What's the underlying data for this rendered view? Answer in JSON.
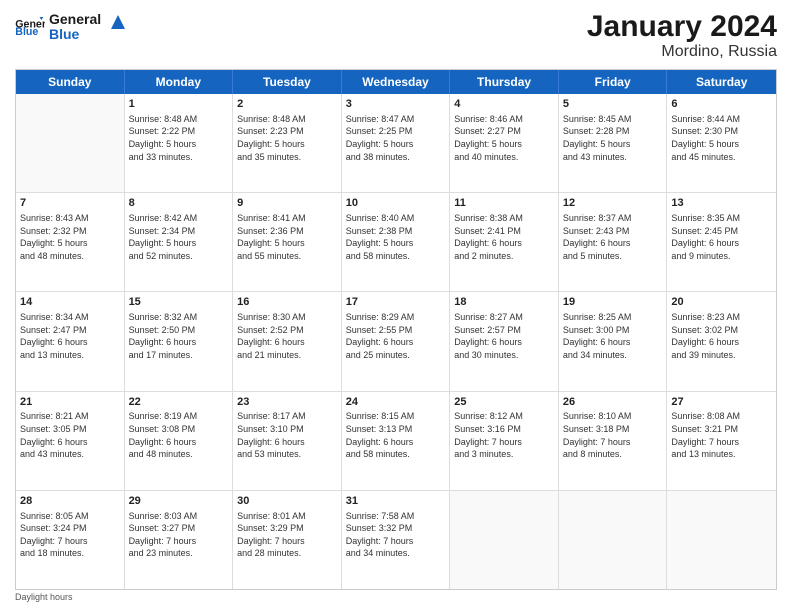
{
  "logo": {
    "line1": "General",
    "line2": "Blue"
  },
  "title": "January 2024",
  "subtitle": "Mordino, Russia",
  "days_of_week": [
    "Sunday",
    "Monday",
    "Tuesday",
    "Wednesday",
    "Thursday",
    "Friday",
    "Saturday"
  ],
  "weeks": [
    [
      {
        "day": "",
        "content": ""
      },
      {
        "day": "1",
        "content": "Sunrise: 8:48 AM\nSunset: 2:22 PM\nDaylight: 5 hours\nand 33 minutes."
      },
      {
        "day": "2",
        "content": "Sunrise: 8:48 AM\nSunset: 2:23 PM\nDaylight: 5 hours\nand 35 minutes."
      },
      {
        "day": "3",
        "content": "Sunrise: 8:47 AM\nSunset: 2:25 PM\nDaylight: 5 hours\nand 38 minutes."
      },
      {
        "day": "4",
        "content": "Sunrise: 8:46 AM\nSunset: 2:27 PM\nDaylight: 5 hours\nand 40 minutes."
      },
      {
        "day": "5",
        "content": "Sunrise: 8:45 AM\nSunset: 2:28 PM\nDaylight: 5 hours\nand 43 minutes."
      },
      {
        "day": "6",
        "content": "Sunrise: 8:44 AM\nSunset: 2:30 PM\nDaylight: 5 hours\nand 45 minutes."
      }
    ],
    [
      {
        "day": "7",
        "content": "Sunrise: 8:43 AM\nSunset: 2:32 PM\nDaylight: 5 hours\nand 48 minutes."
      },
      {
        "day": "8",
        "content": "Sunrise: 8:42 AM\nSunset: 2:34 PM\nDaylight: 5 hours\nand 52 minutes."
      },
      {
        "day": "9",
        "content": "Sunrise: 8:41 AM\nSunset: 2:36 PM\nDaylight: 5 hours\nand 55 minutes."
      },
      {
        "day": "10",
        "content": "Sunrise: 8:40 AM\nSunset: 2:38 PM\nDaylight: 5 hours\nand 58 minutes."
      },
      {
        "day": "11",
        "content": "Sunrise: 8:38 AM\nSunset: 2:41 PM\nDaylight: 6 hours\nand 2 minutes."
      },
      {
        "day": "12",
        "content": "Sunrise: 8:37 AM\nSunset: 2:43 PM\nDaylight: 6 hours\nand 5 minutes."
      },
      {
        "day": "13",
        "content": "Sunrise: 8:35 AM\nSunset: 2:45 PM\nDaylight: 6 hours\nand 9 minutes."
      }
    ],
    [
      {
        "day": "14",
        "content": "Sunrise: 8:34 AM\nSunset: 2:47 PM\nDaylight: 6 hours\nand 13 minutes."
      },
      {
        "day": "15",
        "content": "Sunrise: 8:32 AM\nSunset: 2:50 PM\nDaylight: 6 hours\nand 17 minutes."
      },
      {
        "day": "16",
        "content": "Sunrise: 8:30 AM\nSunset: 2:52 PM\nDaylight: 6 hours\nand 21 minutes."
      },
      {
        "day": "17",
        "content": "Sunrise: 8:29 AM\nSunset: 2:55 PM\nDaylight: 6 hours\nand 25 minutes."
      },
      {
        "day": "18",
        "content": "Sunrise: 8:27 AM\nSunset: 2:57 PM\nDaylight: 6 hours\nand 30 minutes."
      },
      {
        "day": "19",
        "content": "Sunrise: 8:25 AM\nSunset: 3:00 PM\nDaylight: 6 hours\nand 34 minutes."
      },
      {
        "day": "20",
        "content": "Sunrise: 8:23 AM\nSunset: 3:02 PM\nDaylight: 6 hours\nand 39 minutes."
      }
    ],
    [
      {
        "day": "21",
        "content": "Sunrise: 8:21 AM\nSunset: 3:05 PM\nDaylight: 6 hours\nand 43 minutes."
      },
      {
        "day": "22",
        "content": "Sunrise: 8:19 AM\nSunset: 3:08 PM\nDaylight: 6 hours\nand 48 minutes."
      },
      {
        "day": "23",
        "content": "Sunrise: 8:17 AM\nSunset: 3:10 PM\nDaylight: 6 hours\nand 53 minutes."
      },
      {
        "day": "24",
        "content": "Sunrise: 8:15 AM\nSunset: 3:13 PM\nDaylight: 6 hours\nand 58 minutes."
      },
      {
        "day": "25",
        "content": "Sunrise: 8:12 AM\nSunset: 3:16 PM\nDaylight: 7 hours\nand 3 minutes."
      },
      {
        "day": "26",
        "content": "Sunrise: 8:10 AM\nSunset: 3:18 PM\nDaylight: 7 hours\nand 8 minutes."
      },
      {
        "day": "27",
        "content": "Sunrise: 8:08 AM\nSunset: 3:21 PM\nDaylight: 7 hours\nand 13 minutes."
      }
    ],
    [
      {
        "day": "28",
        "content": "Sunrise: 8:05 AM\nSunset: 3:24 PM\nDaylight: 7 hours\nand 18 minutes."
      },
      {
        "day": "29",
        "content": "Sunrise: 8:03 AM\nSunset: 3:27 PM\nDaylight: 7 hours\nand 23 minutes."
      },
      {
        "day": "30",
        "content": "Sunrise: 8:01 AM\nSunset: 3:29 PM\nDaylight: 7 hours\nand 28 minutes."
      },
      {
        "day": "31",
        "content": "Sunrise: 7:58 AM\nSunset: 3:32 PM\nDaylight: 7 hours\nand 34 minutes."
      },
      {
        "day": "",
        "content": ""
      },
      {
        "day": "",
        "content": ""
      },
      {
        "day": "",
        "content": ""
      }
    ]
  ],
  "footer": "Daylight hours"
}
